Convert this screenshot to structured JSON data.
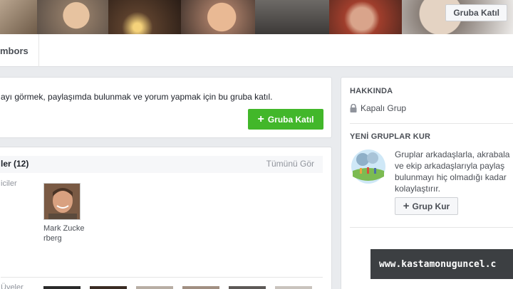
{
  "cover": {
    "join_button_label": "Gruba Katıl"
  },
  "tabs": {
    "members_label": "mbors"
  },
  "join_box": {
    "message": "ayı görmek, paylaşımda bulunmak ve yorum yapmak için bu gruba katıl.",
    "button_label": "Gruba Katıl",
    "button_color": "#42b72a"
  },
  "members": {
    "title": "ler (12)",
    "see_all_label": "Tümünü Gör",
    "admins_label": "iciler",
    "admin_name": "Mark Zuckerberg",
    "users_label": "Üyeler"
  },
  "about": {
    "title": "HAKKINDA",
    "privacy": "Kapalı Grup",
    "privacy_icon": "lock-icon"
  },
  "create_group": {
    "title": "YENİ GRUPLAR KUR",
    "description": "Gruplar arkadaşlarla, akrabala\nve ekip arkadaşlarıyla paylaş\nbulunmayı hiç olmadığı kadar\nkolaylaştırır.",
    "button_label": "Grup Kur"
  },
  "watermark": {
    "text": "www.kastamonuguncel.c"
  }
}
